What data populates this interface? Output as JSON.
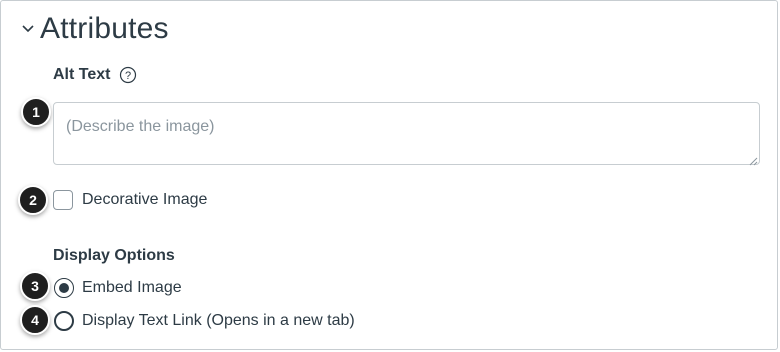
{
  "section": {
    "title": "Attributes",
    "collapse_icon": "chevron-down-icon"
  },
  "alt_text": {
    "label": "Alt Text",
    "help_icon": "question-circle-icon",
    "placeholder": "(Describe the image)",
    "value": ""
  },
  "decorative": {
    "label": "Decorative Image",
    "checked": false
  },
  "display_options": {
    "label": "Display Options",
    "options": [
      {
        "label": "Embed Image",
        "selected": true
      },
      {
        "label": "Display Text Link (Opens in a new tab)",
        "selected": false
      }
    ]
  },
  "callouts": [
    "1",
    "2",
    "3",
    "4"
  ],
  "colors": {
    "text": "#2d3b45",
    "border": "#c7cdd1",
    "placeholder": "#8b969e",
    "callout_bg": "#1f1f1f"
  }
}
